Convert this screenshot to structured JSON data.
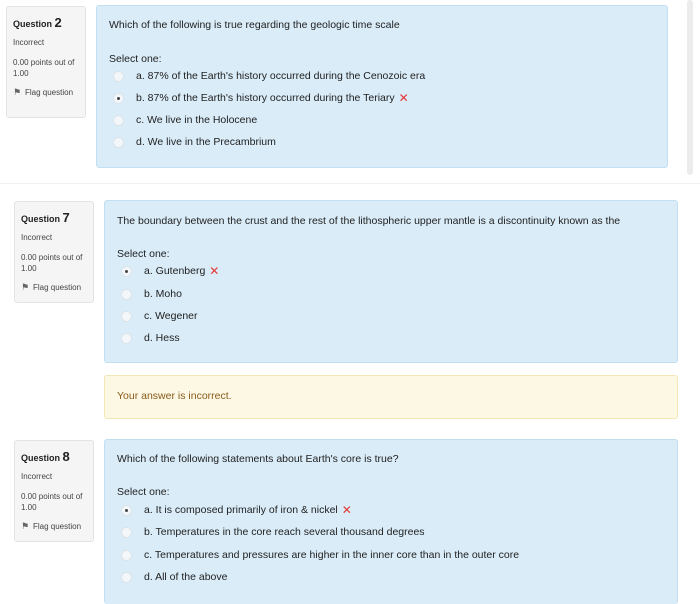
{
  "questions": [
    {
      "label": "Question",
      "number": "2",
      "state": "Incorrect",
      "grade": "0.00 points out of 1.00",
      "flag_label": "Flag question",
      "text": "Which of the following is true regarding the geologic time scale",
      "prompt": "Select one:",
      "options": [
        {
          "text": "a. 87% of the Earth's history occurred during the Cenozoic era"
        },
        {
          "text": "b. 87% of the Earth's history occurred during the Teriary"
        },
        {
          "text": "c. We live in the Holocene"
        },
        {
          "text": "d. We live in the Precambrium"
        }
      ]
    },
    {
      "label": "Question",
      "number": "7",
      "state": "Incorrect",
      "grade": "0.00 points out of 1.00",
      "flag_label": "Flag question",
      "text": "The boundary between the crust and the rest of the lithospheric upper mantle is a discontinuity known as the",
      "prompt": "Select one:",
      "options": [
        {
          "text": "a. Gutenberg"
        },
        {
          "text": "b. Moho"
        },
        {
          "text": "c. Wegener"
        },
        {
          "text": "d. Hess"
        }
      ],
      "feedback": "Your answer is incorrect."
    },
    {
      "label": "Question",
      "number": "8",
      "state": "Incorrect",
      "grade": "0.00 points out of 1.00",
      "flag_label": "Flag question",
      "text": "Which of the following statements about Earth's core is true?",
      "prompt": "Select one:",
      "options": [
        {
          "text": "a. It is composed primarily of iron & nickel"
        },
        {
          "text": "b. Temperatures in the core reach several thousand degrees"
        },
        {
          "text": "c. Temperatures and pressures are higher in the inner core than in the outer core"
        },
        {
          "text": "d. All of the above"
        }
      ]
    }
  ],
  "colors": {
    "formulation_bg": "#d9ecf8",
    "feedback_bg": "#fcf8e3",
    "incorrect_mark": "#e53935"
  }
}
